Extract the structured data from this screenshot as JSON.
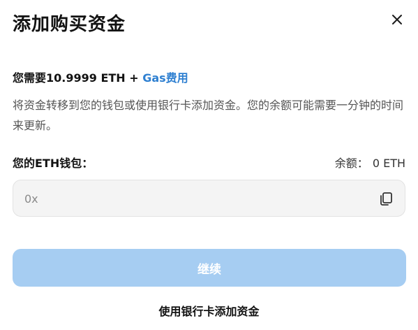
{
  "modal": {
    "title": "添加购买资金",
    "close_icon": "close-icon"
  },
  "requirement": {
    "prefix": "您需要",
    "amount": "10.9999 ETH",
    "plus": " + ",
    "gas_link": "Gas费用"
  },
  "description": "将资金转移到您的钱包或使用银行卡添加资金。您的余额可能需要一分钟的时间来更新。",
  "wallet": {
    "label": "您的ETH钱包：",
    "balance_label": "余额：",
    "balance_value": "0 ETH",
    "address_placeholder": "0x",
    "address_value": "",
    "copy_icon": "copy-icon"
  },
  "actions": {
    "continue_label": "继续",
    "bank_card_label": "使用银行卡添加资金"
  },
  "colors": {
    "link": "#2f80d1",
    "button_disabled": "#a6cdf2"
  }
}
